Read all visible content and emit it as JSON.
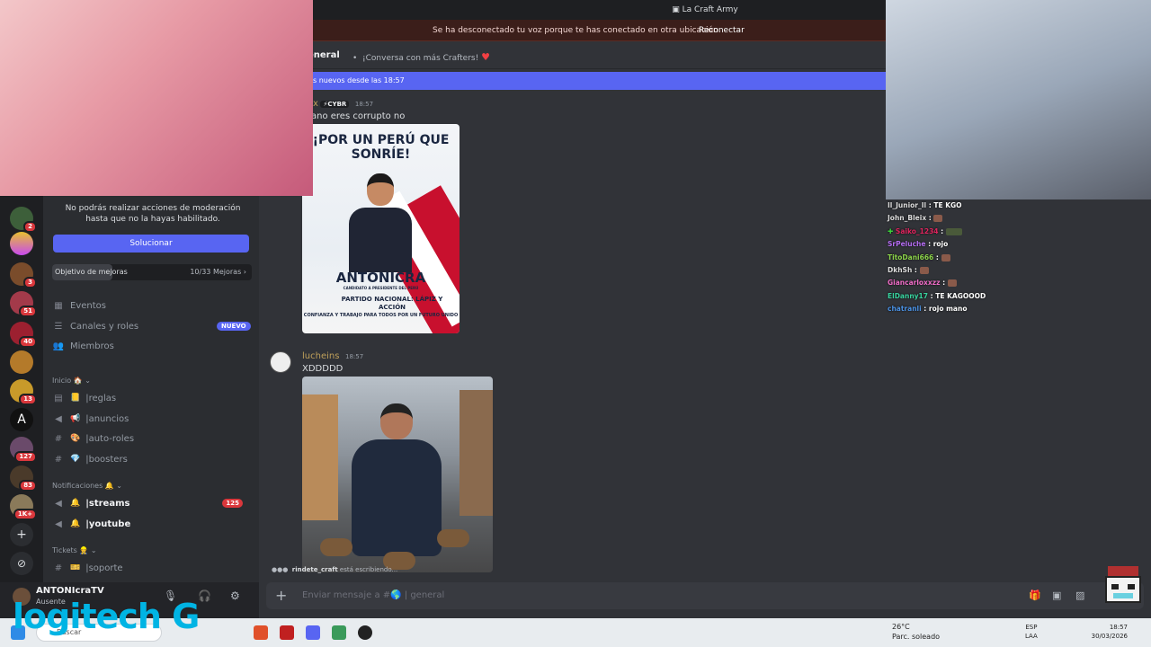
{
  "window": {
    "title": "La Craft Army"
  },
  "disconnect_banner": {
    "message": "Se ha desconectado tu voz porque te has conectado en otra ubicación.",
    "action": "Reconectar"
  },
  "channel_header": {
    "name": "eneral",
    "topic": "¡Conversa con más Crafters!"
  },
  "new_messages_bar": {
    "text": "s nuevos desde las 18:57"
  },
  "sidebar": {
    "moderation_note": "No podrás realizar acciones de moderación hasta que no la hayas habilitado.",
    "solve_button": "Solucionar",
    "goal": {
      "label": "Objetivo de mejoras",
      "progress": "10/33 Mejoras",
      "fraction": 0.303
    },
    "items": [
      {
        "icon": "calendar-icon",
        "label": "Eventos"
      },
      {
        "icon": "channels-icon",
        "label": "Canales y roles",
        "badge": "NUEVO"
      },
      {
        "icon": "members-icon",
        "label": "Miembros"
      }
    ],
    "categories": [
      {
        "name": "Inicio 🏠",
        "channels": [
          {
            "name": "reglas",
            "emoji": "📒"
          },
          {
            "name": "anuncios",
            "emoji": "📢"
          },
          {
            "name": "auto-roles",
            "emoji": "🎨"
          },
          {
            "name": "boosters",
            "emoji": "💎"
          }
        ]
      },
      {
        "name": "Notificaciones 🔔",
        "channels": [
          {
            "name": "streams",
            "emoji": "🔔",
            "unread": "125"
          },
          {
            "name": "youtube",
            "emoji": "🔔"
          }
        ]
      },
      {
        "name": "Tickets 👷",
        "channels": [
          {
            "name": "soporte",
            "emoji": "🎫"
          }
        ]
      }
    ]
  },
  "server_rail": {
    "badges": [
      "2",
      "3",
      "51",
      "40",
      "13",
      "127",
      "83",
      "1K+"
    ]
  },
  "user_panel": {
    "name": "ANTONIcraTV",
    "status": "Ausente"
  },
  "messages": [
    {
      "author": "x",
      "tag": "⚡CYBR",
      "time": "18:57",
      "text": "ano eres corrupto no",
      "poster": {
        "headline": "¡POR UN PERÚ QUE SONRÍE!",
        "name": "ANTONICRA",
        "subtitle": "CANDIDATO A PRESIDENTE DEL PERÚ",
        "party": "PARTIDO NACIONAL: LÁPIZ Y ACCIÓN",
        "motto": "CONFIANZA Y TRABAJO PARA TODOS POR UN FUTURO UNIDO"
      }
    },
    {
      "author": "lucheins",
      "time": "18:57",
      "text": "XDDDDD"
    }
  ],
  "typing": {
    "user": "rindete_craft",
    "suffix": "está escribiendo..."
  },
  "composer": {
    "placeholder": "Enviar mensaje a #🌎 | general"
  },
  "stream_chat": [
    {
      "user": "Il_Junior_Il",
      "color": "#dcdcdc",
      "text": "TE KGO"
    },
    {
      "user": "John_Bleix",
      "color": "#dcdcdc",
      "text": ""
    },
    {
      "user": "Saiko_1234",
      "color": "#e0245e",
      "text": ""
    },
    {
      "user": "SrPeluche",
      "color": "#b36cf0",
      "text": "rojo"
    },
    {
      "user": "TitoDani666",
      "color": "#8bd24a",
      "text": ""
    },
    {
      "user": "DkhSh",
      "color": "#dcdcdc",
      "text": ""
    },
    {
      "user": "Giancarloxxzz",
      "color": "#ee6cc6",
      "text": ""
    },
    {
      "user": "ElDanny17",
      "color": "#38d39f",
      "text": "TE KAGOOOD"
    },
    {
      "user": "chatranli",
      "color": "#4a90e2",
      "text": "rojo mano"
    }
  ],
  "taskbar": {
    "search_placeholder": "Buscar",
    "weather": {
      "temp": "26°C",
      "desc": "Parc. soleado"
    },
    "lang": [
      "ESP",
      "LAA"
    ],
    "time": "18:57",
    "date": "30/03/2026"
  },
  "overlay": {
    "brand": "logitech G"
  },
  "colors": {
    "accent": "#5865f2",
    "danger": "#da373c",
    "bg": "#313338"
  }
}
